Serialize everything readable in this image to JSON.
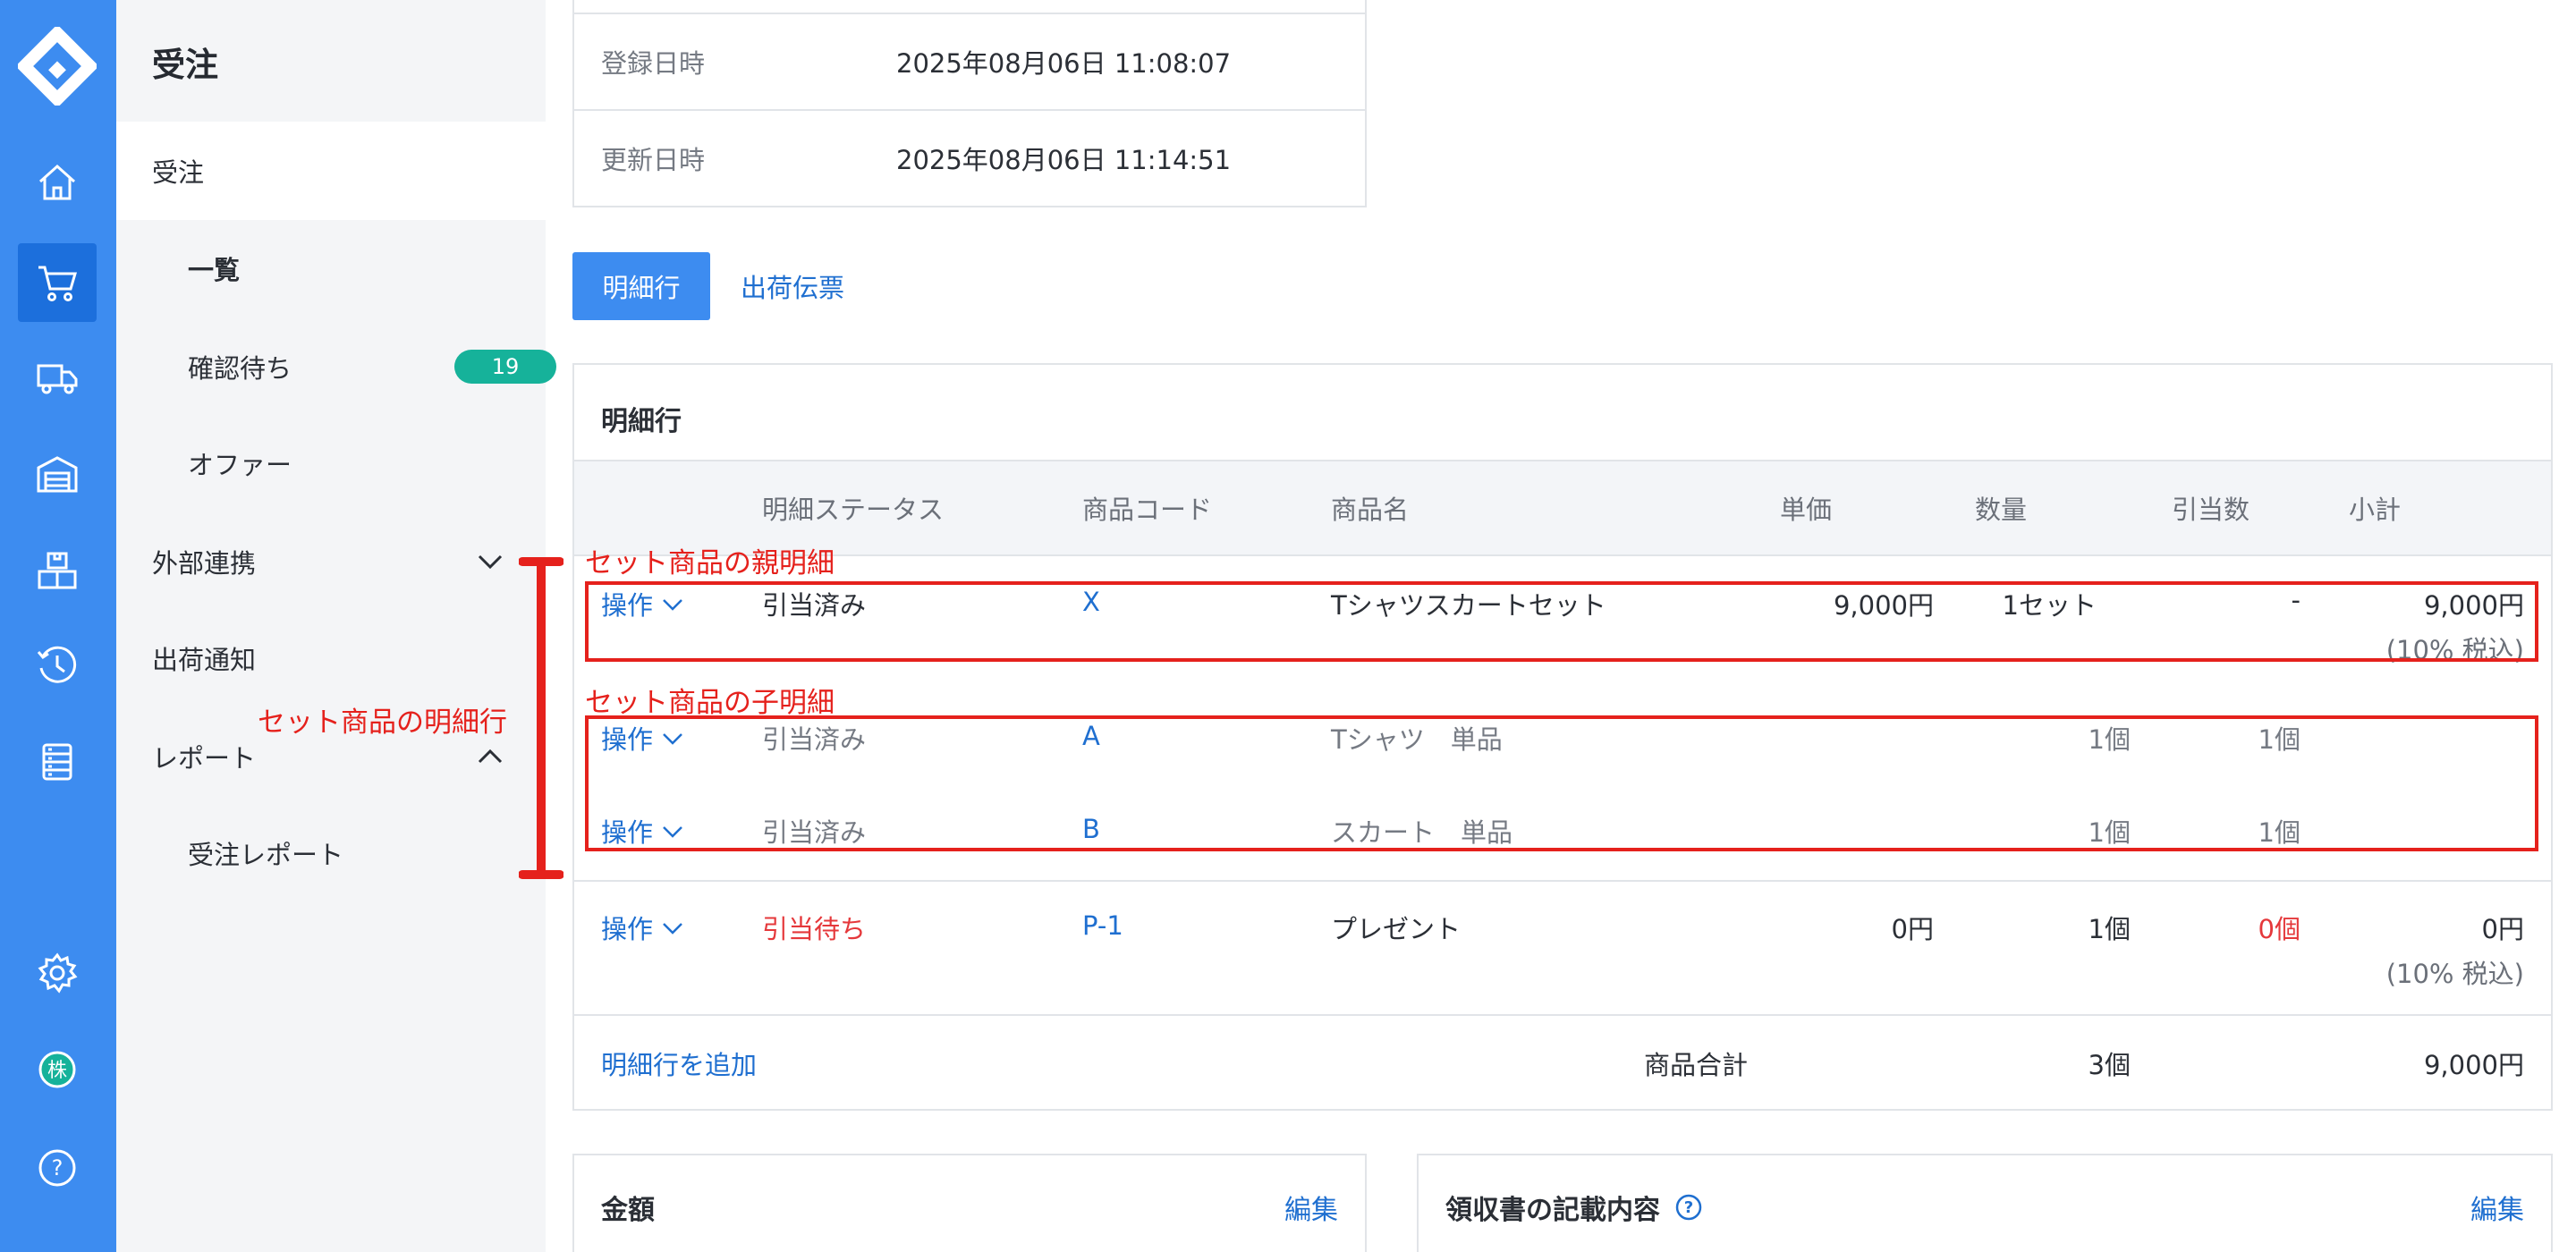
{
  "rail": {
    "logo": "brand-logo",
    "items": [
      {
        "icon": "home-icon"
      },
      {
        "icon": "cart-icon",
        "active": true
      },
      {
        "icon": "truck-icon"
      },
      {
        "icon": "warehouse-icon"
      },
      {
        "icon": "boxes-icon"
      },
      {
        "icon": "history-icon"
      },
      {
        "icon": "database-icon"
      },
      {
        "icon": "gear-icon"
      },
      {
        "icon": "company-avatar-icon",
        "label": "株"
      },
      {
        "icon": "help-icon",
        "label": "?"
      }
    ]
  },
  "subnav": {
    "title": "受注",
    "items": [
      {
        "label": "受注"
      },
      {
        "label": "一覧",
        "selected": true
      },
      {
        "label": "確認待ち",
        "badge": "19"
      },
      {
        "label": "オファー"
      },
      {
        "label": "外部連携",
        "chevron": "down"
      },
      {
        "label": "出荷通知"
      },
      {
        "label": "レポート",
        "chevron": "up"
      },
      {
        "label": "受注レポート"
      }
    ]
  },
  "meta": {
    "rows": [
      {
        "label": "登録日時",
        "value": "2025年08月06日 11:08:07"
      },
      {
        "label": "更新日時",
        "value": "2025年08月06日 11:14:51"
      }
    ]
  },
  "tabs": {
    "detail": "明細行",
    "shipping": "出荷伝票"
  },
  "lines": {
    "title": "明細行",
    "columns": [
      "明細ステータス",
      "商品コード",
      "商品名",
      "単価",
      "数量",
      "引当数",
      "小計"
    ],
    "rows": [
      {
        "op": "操作",
        "status": "引当済み",
        "code": "X",
        "name": "Tシャツスカートセット",
        "price": "9,000円",
        "qty": "1セット",
        "alloc": "-",
        "subtotal": "9,000円",
        "tax": "(10% 税込)"
      },
      {
        "op": "操作",
        "status": "引当済み",
        "code": "A",
        "name": "Tシャツ　単品",
        "qty": "1個",
        "alloc": "1個"
      },
      {
        "op": "操作",
        "status": "引当済み",
        "code": "B",
        "name": "スカート　単品",
        "qty": "1個",
        "alloc": "1個"
      },
      {
        "op": "操作",
        "status": "引当待ち",
        "code": "P-1",
        "name": "プレゼント",
        "price": "0円",
        "qty": "1個",
        "alloc": "0個",
        "subtotal": "0円",
        "tax": "(10% 税込)"
      }
    ],
    "footer": {
      "add_link": "明細行を追加",
      "total_label": "商品合計",
      "total_qty": "3個",
      "total_amount": "9,000円"
    }
  },
  "amount_box": {
    "title": "金額",
    "edit": "編集"
  },
  "receipt_box": {
    "title": "領収書の記載内容",
    "help": "?",
    "edit": "編集"
  },
  "annotations": {
    "parent": "セット商品の親明細",
    "child": "セット商品の子明細",
    "side": "セット商品の明細行"
  },
  "colors": {
    "rail": "#3d8cf0",
    "accent": "#1f6fd0",
    "badge": "#16b29a",
    "annotation": "#e5211c",
    "warning": "#e5383b"
  }
}
